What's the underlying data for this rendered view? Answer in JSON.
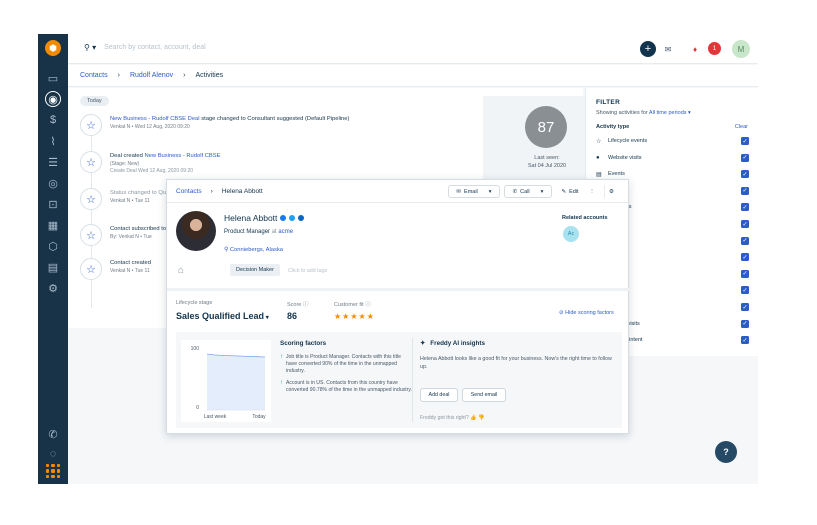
{
  "topbar": {
    "search_placeholder": "Search by contact, account, deal",
    "user_initial": "M",
    "notif_count": "1",
    "bell_count": "0"
  },
  "breadcrumb": {
    "contacts": "Contacts",
    "contact": "Rudolf Alenov",
    "page": "Activities"
  },
  "timeline": {
    "today": "Today",
    "items": [
      {
        "t1a": "New Business - Rudolf CBSE Deal",
        "t1b": " stage changed to Consultant suggested (Default Pipeline)",
        "t2": "Venkat N  •  Wed 12 Aug, 2020 09:20",
        "t3": ""
      },
      {
        "t1a": "Deal created ",
        "t1b": "New Business - Rudolf CBSE",
        "t2": "(Stage: New)",
        "t3": "Create Deal Wed 12 Aug, 2020 09:20"
      },
      {
        "t1a": "Status changed to ",
        "t1b": "Qu",
        "t2": "Venkat N  •  Tue 11",
        "t3": ""
      },
      {
        "t1a": "Contact subscribed to",
        "t1b": "",
        "t2": "By: Venkat N  •  Tue",
        "t3": ""
      },
      {
        "t1a": "Contact created",
        "t1b": "",
        "t2": "Venkat N  •  Tue 11",
        "t3": ""
      }
    ],
    "score": "87",
    "last_seen_label": "Last seen:",
    "last_seen": "Sat 04 Jul 2020"
  },
  "filter": {
    "title": "FILTER",
    "showing": "Showing activities for",
    "period": "All time periods",
    "activity_type": "Activity type",
    "clear": "Clear",
    "rows": [
      {
        "icon": "☆",
        "label": "Lifecycle events"
      },
      {
        "icon": "●",
        "label": "Website visits"
      },
      {
        "icon": "▤",
        "label": "Events"
      },
      {
        "icon": "",
        "label": "ads"
      },
      {
        "icon": "",
        "label": "ng emails"
      },
      {
        "icon": "",
        "label": "events"
      },
      {
        "icon": "",
        "label": "ails"
      },
      {
        "icon": "",
        "label": ""
      },
      {
        "icon": "",
        "label": ""
      },
      {
        "icon": "",
        "label": "ments"
      },
      {
        "icon": "",
        "label": ""
      },
      {
        "icon": "",
        "label": "G page visits"
      },
      {
        "icon": "",
        "label": "urchase intent"
      }
    ]
  },
  "popup": {
    "crumb_contacts": "Contacts",
    "crumb_name": "Helena Abbott",
    "email": "Email",
    "call": "Call",
    "edit": "Edit",
    "name": "Helena Abbott",
    "job": "Product Manager",
    "at": " at ",
    "company": "acme",
    "location": "Conniebergs, Alaska",
    "tag": "Decision Maker",
    "tag_add": "Click to add tags",
    "related": "Related accounts",
    "related_avatar": "Ac",
    "lifecycle_label": "Lifecycle stage",
    "lifecycle": "Sales Qualified Lead",
    "score_label": "Score",
    "score": "86",
    "fit_label": "Customer fit",
    "hide": "Hide scoring factors",
    "chart_y_top": "100",
    "chart_y_bottom": "0",
    "chart_x_left": "Last week",
    "chart_x_right": "Today",
    "scoring_title": "Scoring factors",
    "factors": [
      "Job title is Product Manager. Contacts with this title have converted 90% of the time in the unmapped industry.",
      "Account is in US. Contacts from this country have converted 90.78% of the time in the unmapped industry."
    ],
    "freddy_title": "Freddy AI insights",
    "freddy_text": "Helena Abbott looks like a good fit for your business. Now's the right time to follow up.",
    "add_deal": "Add deal",
    "send_email": "Send email",
    "got_right": "Freddy got this right?"
  },
  "help": "?",
  "colors": {
    "primary": "#2c5cc5",
    "nav": "#183247",
    "brand": "#f28b00",
    "alert": "#e43538"
  }
}
